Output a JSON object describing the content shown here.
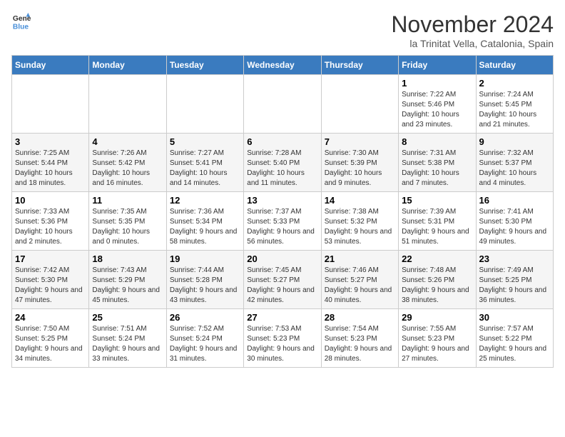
{
  "header": {
    "logo_line1": "General",
    "logo_line2": "Blue",
    "month": "November 2024",
    "location": "la Trinitat Vella, Catalonia, Spain"
  },
  "weekdays": [
    "Sunday",
    "Monday",
    "Tuesday",
    "Wednesday",
    "Thursday",
    "Friday",
    "Saturday"
  ],
  "weeks": [
    [
      {
        "day": "",
        "info": ""
      },
      {
        "day": "",
        "info": ""
      },
      {
        "day": "",
        "info": ""
      },
      {
        "day": "",
        "info": ""
      },
      {
        "day": "",
        "info": ""
      },
      {
        "day": "1",
        "info": "Sunrise: 7:22 AM\nSunset: 5:46 PM\nDaylight: 10 hours and 23 minutes."
      },
      {
        "day": "2",
        "info": "Sunrise: 7:24 AM\nSunset: 5:45 PM\nDaylight: 10 hours and 21 minutes."
      }
    ],
    [
      {
        "day": "3",
        "info": "Sunrise: 7:25 AM\nSunset: 5:44 PM\nDaylight: 10 hours and 18 minutes."
      },
      {
        "day": "4",
        "info": "Sunrise: 7:26 AM\nSunset: 5:42 PM\nDaylight: 10 hours and 16 minutes."
      },
      {
        "day": "5",
        "info": "Sunrise: 7:27 AM\nSunset: 5:41 PM\nDaylight: 10 hours and 14 minutes."
      },
      {
        "day": "6",
        "info": "Sunrise: 7:28 AM\nSunset: 5:40 PM\nDaylight: 10 hours and 11 minutes."
      },
      {
        "day": "7",
        "info": "Sunrise: 7:30 AM\nSunset: 5:39 PM\nDaylight: 10 hours and 9 minutes."
      },
      {
        "day": "8",
        "info": "Sunrise: 7:31 AM\nSunset: 5:38 PM\nDaylight: 10 hours and 7 minutes."
      },
      {
        "day": "9",
        "info": "Sunrise: 7:32 AM\nSunset: 5:37 PM\nDaylight: 10 hours and 4 minutes."
      }
    ],
    [
      {
        "day": "10",
        "info": "Sunrise: 7:33 AM\nSunset: 5:36 PM\nDaylight: 10 hours and 2 minutes."
      },
      {
        "day": "11",
        "info": "Sunrise: 7:35 AM\nSunset: 5:35 PM\nDaylight: 10 hours and 0 minutes."
      },
      {
        "day": "12",
        "info": "Sunrise: 7:36 AM\nSunset: 5:34 PM\nDaylight: 9 hours and 58 minutes."
      },
      {
        "day": "13",
        "info": "Sunrise: 7:37 AM\nSunset: 5:33 PM\nDaylight: 9 hours and 56 minutes."
      },
      {
        "day": "14",
        "info": "Sunrise: 7:38 AM\nSunset: 5:32 PM\nDaylight: 9 hours and 53 minutes."
      },
      {
        "day": "15",
        "info": "Sunrise: 7:39 AM\nSunset: 5:31 PM\nDaylight: 9 hours and 51 minutes."
      },
      {
        "day": "16",
        "info": "Sunrise: 7:41 AM\nSunset: 5:30 PM\nDaylight: 9 hours and 49 minutes."
      }
    ],
    [
      {
        "day": "17",
        "info": "Sunrise: 7:42 AM\nSunset: 5:30 PM\nDaylight: 9 hours and 47 minutes."
      },
      {
        "day": "18",
        "info": "Sunrise: 7:43 AM\nSunset: 5:29 PM\nDaylight: 9 hours and 45 minutes."
      },
      {
        "day": "19",
        "info": "Sunrise: 7:44 AM\nSunset: 5:28 PM\nDaylight: 9 hours and 43 minutes."
      },
      {
        "day": "20",
        "info": "Sunrise: 7:45 AM\nSunset: 5:27 PM\nDaylight: 9 hours and 42 minutes."
      },
      {
        "day": "21",
        "info": "Sunrise: 7:46 AM\nSunset: 5:27 PM\nDaylight: 9 hours and 40 minutes."
      },
      {
        "day": "22",
        "info": "Sunrise: 7:48 AM\nSunset: 5:26 PM\nDaylight: 9 hours and 38 minutes."
      },
      {
        "day": "23",
        "info": "Sunrise: 7:49 AM\nSunset: 5:25 PM\nDaylight: 9 hours and 36 minutes."
      }
    ],
    [
      {
        "day": "24",
        "info": "Sunrise: 7:50 AM\nSunset: 5:25 PM\nDaylight: 9 hours and 34 minutes."
      },
      {
        "day": "25",
        "info": "Sunrise: 7:51 AM\nSunset: 5:24 PM\nDaylight: 9 hours and 33 minutes."
      },
      {
        "day": "26",
        "info": "Sunrise: 7:52 AM\nSunset: 5:24 PM\nDaylight: 9 hours and 31 minutes."
      },
      {
        "day": "27",
        "info": "Sunrise: 7:53 AM\nSunset: 5:23 PM\nDaylight: 9 hours and 30 minutes."
      },
      {
        "day": "28",
        "info": "Sunrise: 7:54 AM\nSunset: 5:23 PM\nDaylight: 9 hours and 28 minutes."
      },
      {
        "day": "29",
        "info": "Sunrise: 7:55 AM\nSunset: 5:23 PM\nDaylight: 9 hours and 27 minutes."
      },
      {
        "day": "30",
        "info": "Sunrise: 7:57 AM\nSunset: 5:22 PM\nDaylight: 9 hours and 25 minutes."
      }
    ]
  ]
}
